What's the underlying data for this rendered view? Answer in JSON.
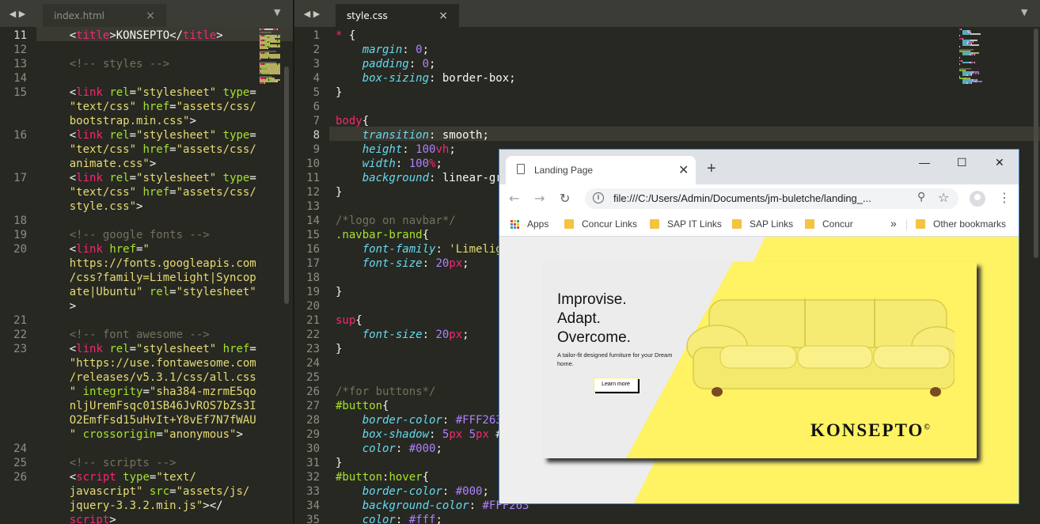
{
  "left_editor": {
    "tab_label": "index.html",
    "tab_close": "×",
    "nav_arrows": "◀ ▶",
    "menu_arrow": "▼",
    "lines": [
      {
        "n": "11",
        "hl": true,
        "segs": [
          [
            "w",
            "    <"
          ],
          [
            "t",
            "title"
          ],
          [
            "w",
            ">KONSEPTO</"
          ],
          [
            "t",
            "title"
          ],
          [
            "w",
            ">"
          ]
        ]
      },
      {
        "n": "12",
        "segs": []
      },
      {
        "n": "13",
        "segs": [
          [
            "c",
            "    <!-- styles -->"
          ]
        ]
      },
      {
        "n": "14",
        "segs": []
      },
      {
        "n": "15",
        "segs": [
          [
            "w",
            "    <"
          ],
          [
            "t",
            "link"
          ],
          [
            "w",
            " "
          ],
          [
            "a",
            "rel"
          ],
          [
            "w",
            "="
          ],
          [
            "s",
            "\"stylesheet\""
          ],
          [
            "w",
            " "
          ],
          [
            "a",
            "type"
          ],
          [
            "w",
            "="
          ]
        ]
      },
      {
        "n": "",
        "segs": [
          [
            "s",
            "    \"text/css\""
          ],
          [
            "w",
            " "
          ],
          [
            "a",
            "href"
          ],
          [
            "w",
            "="
          ],
          [
            "s",
            "\"assets/css/"
          ]
        ]
      },
      {
        "n": "",
        "segs": [
          [
            "s",
            "    bootstrap.min.css\""
          ],
          [
            "w",
            ">"
          ]
        ]
      },
      {
        "n": "16",
        "segs": [
          [
            "w",
            "    <"
          ],
          [
            "t",
            "link"
          ],
          [
            "w",
            " "
          ],
          [
            "a",
            "rel"
          ],
          [
            "w",
            "="
          ],
          [
            "s",
            "\"stylesheet\""
          ],
          [
            "w",
            " "
          ],
          [
            "a",
            "type"
          ],
          [
            "w",
            "="
          ]
        ]
      },
      {
        "n": "",
        "segs": [
          [
            "s",
            "    \"text/css\""
          ],
          [
            "w",
            " "
          ],
          [
            "a",
            "href"
          ],
          [
            "w",
            "="
          ],
          [
            "s",
            "\"assets/css/"
          ]
        ]
      },
      {
        "n": "",
        "segs": [
          [
            "s",
            "    animate.css\""
          ],
          [
            "w",
            ">"
          ]
        ]
      },
      {
        "n": "17",
        "segs": [
          [
            "w",
            "    <"
          ],
          [
            "t",
            "link"
          ],
          [
            "w",
            " "
          ],
          [
            "a",
            "rel"
          ],
          [
            "w",
            "="
          ],
          [
            "s",
            "\"stylesheet\""
          ],
          [
            "w",
            " "
          ],
          [
            "a",
            "type"
          ],
          [
            "w",
            "="
          ]
        ]
      },
      {
        "n": "",
        "segs": [
          [
            "s",
            "    \"text/css\""
          ],
          [
            "w",
            " "
          ],
          [
            "a",
            "href"
          ],
          [
            "w",
            "="
          ],
          [
            "s",
            "\"assets/css/"
          ]
        ]
      },
      {
        "n": "",
        "segs": [
          [
            "s",
            "    style.css\""
          ],
          [
            "w",
            ">"
          ]
        ]
      },
      {
        "n": "18",
        "segs": []
      },
      {
        "n": "19",
        "segs": [
          [
            "c",
            "    <!-- google fonts -->"
          ]
        ]
      },
      {
        "n": "20",
        "segs": [
          [
            "w",
            "    <"
          ],
          [
            "t",
            "link"
          ],
          [
            "w",
            " "
          ],
          [
            "a",
            "href"
          ],
          [
            "w",
            "="
          ],
          [
            "s",
            "\""
          ]
        ]
      },
      {
        "n": "",
        "segs": [
          [
            "s",
            "    https://fonts.googleapis.com"
          ]
        ]
      },
      {
        "n": "",
        "segs": [
          [
            "s",
            "    /css?family=Limelight|Syncop"
          ]
        ]
      },
      {
        "n": "",
        "segs": [
          [
            "s",
            "    ate|Ubuntu\""
          ],
          [
            "w",
            " "
          ],
          [
            "a",
            "rel"
          ],
          [
            "w",
            "="
          ],
          [
            "s",
            "\"stylesheet\""
          ]
        ]
      },
      {
        "n": "",
        "segs": [
          [
            "w",
            "    >"
          ]
        ]
      },
      {
        "n": "21",
        "segs": []
      },
      {
        "n": "22",
        "segs": [
          [
            "c",
            "    <!-- font awesome -->"
          ]
        ]
      },
      {
        "n": "23",
        "segs": [
          [
            "w",
            "    <"
          ],
          [
            "t",
            "link"
          ],
          [
            "w",
            " "
          ],
          [
            "a",
            "rel"
          ],
          [
            "w",
            "="
          ],
          [
            "s",
            "\"stylesheet\""
          ],
          [
            "w",
            " "
          ],
          [
            "a",
            "href"
          ],
          [
            "w",
            "="
          ]
        ]
      },
      {
        "n": "",
        "segs": [
          [
            "s",
            "    \"https://use.fontawesome.com"
          ]
        ]
      },
      {
        "n": "",
        "segs": [
          [
            "s",
            "    /releases/v5.3.1/css/all.css"
          ]
        ]
      },
      {
        "n": "",
        "segs": [
          [
            "s",
            "    \""
          ],
          [
            "w",
            " "
          ],
          [
            "a",
            "integrity"
          ],
          [
            "w",
            "="
          ],
          [
            "s",
            "\"sha384-mzrmE5qo"
          ]
        ]
      },
      {
        "n": "",
        "segs": [
          [
            "s",
            "    nljUremFsqc01SB46JvROS7bZs3I"
          ]
        ]
      },
      {
        "n": "",
        "segs": [
          [
            "s",
            "    O2EmfFsd15uHvIt+Y8vEf7N7fWAU"
          ]
        ]
      },
      {
        "n": "",
        "segs": [
          [
            "s",
            "    \""
          ],
          [
            "w",
            " "
          ],
          [
            "a",
            "crossorigin"
          ],
          [
            "w",
            "="
          ],
          [
            "s",
            "\"anonymous\""
          ],
          [
            "w",
            ">"
          ]
        ]
      },
      {
        "n": "24",
        "segs": []
      },
      {
        "n": "25",
        "segs": [
          [
            "c",
            "    <!-- scripts -->"
          ]
        ]
      },
      {
        "n": "26",
        "segs": [
          [
            "w",
            "    <"
          ],
          [
            "t",
            "script"
          ],
          [
            "w",
            " "
          ],
          [
            "a",
            "type"
          ],
          [
            "w",
            "="
          ],
          [
            "s",
            "\"text/"
          ]
        ]
      },
      {
        "n": "",
        "segs": [
          [
            "s",
            "    javascript\""
          ],
          [
            "w",
            " "
          ],
          [
            "a",
            "src"
          ],
          [
            "w",
            "="
          ],
          [
            "s",
            "\"assets/js/"
          ]
        ]
      },
      {
        "n": "",
        "segs": [
          [
            "s",
            "    jquery-3.3.2.min.js\""
          ],
          [
            "w",
            "></"
          ]
        ]
      },
      {
        "n": "",
        "segs": [
          [
            "t",
            "    script"
          ],
          [
            "w",
            ">"
          ]
        ]
      }
    ]
  },
  "right_editor": {
    "tab_label": "style.css",
    "tab_close": "×",
    "nav_arrows": "◀ ▶",
    "menu_arrow": "▼",
    "lines": [
      {
        "n": "1",
        "segs": [
          [
            "t",
            "* "
          ],
          [
            "w",
            "{"
          ]
        ]
      },
      {
        "n": "2",
        "segs": [
          [
            "p",
            "    margin"
          ],
          [
            "w",
            ": "
          ],
          [
            "n",
            "0"
          ],
          [
            "w",
            ";"
          ]
        ]
      },
      {
        "n": "3",
        "segs": [
          [
            "p",
            "    padding"
          ],
          [
            "w",
            ": "
          ],
          [
            "n",
            "0"
          ],
          [
            "w",
            ";"
          ]
        ]
      },
      {
        "n": "4",
        "segs": [
          [
            "p",
            "    box-sizing"
          ],
          [
            "w",
            ": border-box;"
          ]
        ]
      },
      {
        "n": "5",
        "segs": [
          [
            "w",
            "}"
          ]
        ]
      },
      {
        "n": "6",
        "segs": []
      },
      {
        "n": "7",
        "segs": [
          [
            "t",
            "body"
          ],
          [
            "w",
            "{"
          ]
        ]
      },
      {
        "n": "8",
        "hl": true,
        "segs": [
          [
            "p",
            "    transition"
          ],
          [
            "w",
            ": smooth;"
          ]
        ]
      },
      {
        "n": "9",
        "segs": [
          [
            "p",
            "    height"
          ],
          [
            "w",
            ": "
          ],
          [
            "n",
            "100"
          ],
          [
            "t",
            "vh"
          ],
          [
            "w",
            ";"
          ]
        ]
      },
      {
        "n": "10",
        "segs": [
          [
            "p",
            "    width"
          ],
          [
            "w",
            ": "
          ],
          [
            "n",
            "100"
          ],
          [
            "t",
            "%"
          ],
          [
            "w",
            ";"
          ]
        ]
      },
      {
        "n": "11",
        "segs": [
          [
            "p",
            "    background"
          ],
          [
            "w",
            ": linear-gr"
          ]
        ]
      },
      {
        "n": "12",
        "segs": [
          [
            "w",
            "}"
          ]
        ]
      },
      {
        "n": "13",
        "segs": []
      },
      {
        "n": "14",
        "segs": [
          [
            "c",
            "/*logo on navbar*/"
          ]
        ]
      },
      {
        "n": "15",
        "segs": [
          [
            "sel",
            ".navbar-brand"
          ],
          [
            "w",
            "{"
          ]
        ]
      },
      {
        "n": "16",
        "segs": [
          [
            "p",
            "    font-family"
          ],
          [
            "w",
            ": "
          ],
          [
            "s",
            "'Limelig"
          ]
        ]
      },
      {
        "n": "17",
        "segs": [
          [
            "p",
            "    font-size"
          ],
          [
            "w",
            ": "
          ],
          [
            "n",
            "20"
          ],
          [
            "t",
            "px"
          ],
          [
            "w",
            ";"
          ]
        ]
      },
      {
        "n": "18",
        "segs": []
      },
      {
        "n": "19",
        "segs": [
          [
            "w",
            "}"
          ]
        ]
      },
      {
        "n": "20",
        "segs": []
      },
      {
        "n": "21",
        "segs": [
          [
            "t",
            "sup"
          ],
          [
            "w",
            "{"
          ]
        ]
      },
      {
        "n": "22",
        "segs": [
          [
            "p",
            "    font-size"
          ],
          [
            "w",
            ": "
          ],
          [
            "n",
            "20"
          ],
          [
            "t",
            "px"
          ],
          [
            "w",
            ";"
          ]
        ]
      },
      {
        "n": "23",
        "segs": [
          [
            "w",
            "}"
          ]
        ]
      },
      {
        "n": "24",
        "segs": []
      },
      {
        "n": "25",
        "segs": []
      },
      {
        "n": "26",
        "segs": [
          [
            "c",
            "/*for buttons*/"
          ]
        ]
      },
      {
        "n": "27",
        "segs": [
          [
            "sel",
            "#button"
          ],
          [
            "w",
            "{"
          ]
        ]
      },
      {
        "n": "28",
        "segs": [
          [
            "p",
            "    border-color"
          ],
          [
            "w",
            ": "
          ],
          [
            "n",
            "#FFF263"
          ]
        ]
      },
      {
        "n": "29",
        "segs": [
          [
            "p",
            "    box-shadow"
          ],
          [
            "w",
            ": "
          ],
          [
            "n",
            "5"
          ],
          [
            "t",
            "px"
          ],
          [
            "w",
            " "
          ],
          [
            "n",
            "5"
          ],
          [
            "t",
            "px"
          ],
          [
            "w",
            " #"
          ]
        ]
      },
      {
        "n": "30",
        "segs": [
          [
            "p",
            "    color"
          ],
          [
            "w",
            ": "
          ],
          [
            "n",
            "#000"
          ],
          [
            "w",
            ";"
          ]
        ]
      },
      {
        "n": "31",
        "segs": [
          [
            "w",
            "}"
          ]
        ]
      },
      {
        "n": "32",
        "segs": [
          [
            "sel",
            "#button"
          ],
          [
            "w",
            ":"
          ],
          [
            "sel",
            "hover"
          ],
          [
            "w",
            "{"
          ]
        ]
      },
      {
        "n": "33",
        "segs": [
          [
            "p",
            "    border-color"
          ],
          [
            "w",
            ": "
          ],
          [
            "n",
            "#000"
          ],
          [
            "w",
            ";"
          ]
        ]
      },
      {
        "n": "34",
        "segs": [
          [
            "p",
            "    background-color"
          ],
          [
            "w",
            ": "
          ],
          [
            "n",
            "#FFF263"
          ]
        ]
      },
      {
        "n": "35",
        "segs": [
          [
            "p",
            "    color"
          ],
          [
            "w",
            ": "
          ],
          [
            "n",
            "#fff"
          ],
          [
            "w",
            ";"
          ]
        ]
      }
    ]
  },
  "browser": {
    "tab_title": "Landing Page",
    "tab_close": "✕",
    "new_tab": "+",
    "minimize": "—",
    "maximize": "☐",
    "close": "✕",
    "back": "←",
    "forward": "→",
    "reload": "↻",
    "url": "file:///C:/Users/Admin/Documents/jm-buletche/landing_...",
    "bookmarks": [
      {
        "label": "Apps",
        "kind": "apps"
      },
      {
        "label": "Concur Links",
        "kind": "folder"
      },
      {
        "label": "SAP IT Links",
        "kind": "folder"
      },
      {
        "label": "SAP Links",
        "kind": "folder"
      },
      {
        "label": "Concur",
        "kind": "folder"
      }
    ],
    "overflow": "»",
    "other_bookmarks": "Other bookmarks"
  },
  "page": {
    "hero_line1": "Improvise.",
    "hero_line2": "Adapt.",
    "hero_line3": "Overcome.",
    "hero_sub": "A tailor-fit designed furniture for your Dream home.",
    "button_label": "Learn more",
    "brand": "KONSEPTO",
    "brand_mark": "©"
  },
  "colors": {
    "editor_bg": "#272822",
    "accent_yellow": "#fff263",
    "browser_border": "#3b82d6"
  }
}
